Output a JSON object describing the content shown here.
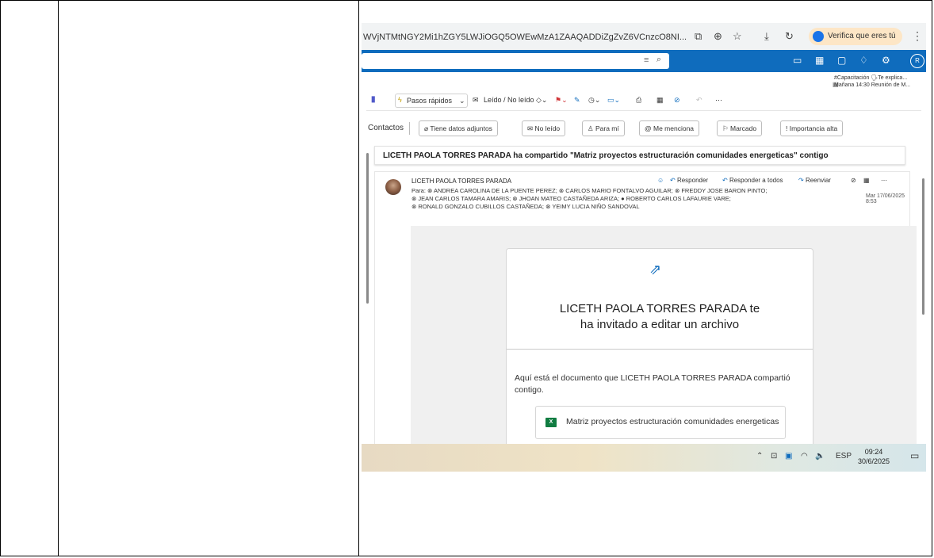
{
  "browser": {
    "url": "WVjNTMtNGY2Mi1hZGY5LWJiOGQ5OWEwMzA1ZAAQADDiZgZvZ6VCnzcO8NI...",
    "verify_label": "Verifica que eres tú"
  },
  "reminder": {
    "line1": "#Capacitación 🗣Te explica...",
    "line2": "Mañana 14:30 Reunión de M..."
  },
  "ribbon": {
    "quick_steps": "Pasos rápidos",
    "read_unread": "Leído / No leído"
  },
  "filters": {
    "contacts": "Contactos",
    "attachments": "Tiene datos adjuntos",
    "unread": "No leído",
    "to_me": "Para mí",
    "mentions": "Me menciona",
    "flagged": "Marcado",
    "high_importance": "Importancia alta"
  },
  "message": {
    "subject": "LICETH PAOLA TORRES PARADA ha compartido \"Matriz proyectos estructuración  comunidades energeticas\" contigo",
    "sender": "LICETH PAOLA TORRES PARADA",
    "reply": "Responder",
    "reply_all": "Responder a todos",
    "forward": "Reenviar",
    "to_line1": "Para: ⊗ ANDREA CAROLINA DE LA PUENTE PEREZ; ⊗ CARLOS MARIO FONTALVO AGUILAR; ⊗ FREDDY JOSE BARON PINTO;",
    "to_line2": "⊗ JEAN CARLOS TAMARA AMARIS; ⊗ JHOAN MATEO CASTAÑEDA ARIZA; ● ROBERTO CARLOS LAFAURIE VARE;",
    "to_line3": "⊗ RONALD GONZALO CUBILLOS CASTAÑEDA; ⊗ YEIMY LUCIA NIÑO SANDOVAL",
    "date": "Mar 17/06/2025 8:53"
  },
  "card": {
    "title_line1": "LICETH PAOLA TORRES PARADA te",
    "title_line2": "ha invitado a editar un archivo",
    "text": "Aquí está el documento que LICETH PAOLA TORRES PARADA compartió contigo.",
    "file_name": "Matriz proyectos estructuración comunidades energeticas",
    "file_icon": "X"
  },
  "taskbar": {
    "lang": "ESP",
    "time": "09:24",
    "date": "30/6/2025"
  },
  "colors": {
    "outlook_blue": "#0f6cbd",
    "excel_green": "#107c41"
  }
}
